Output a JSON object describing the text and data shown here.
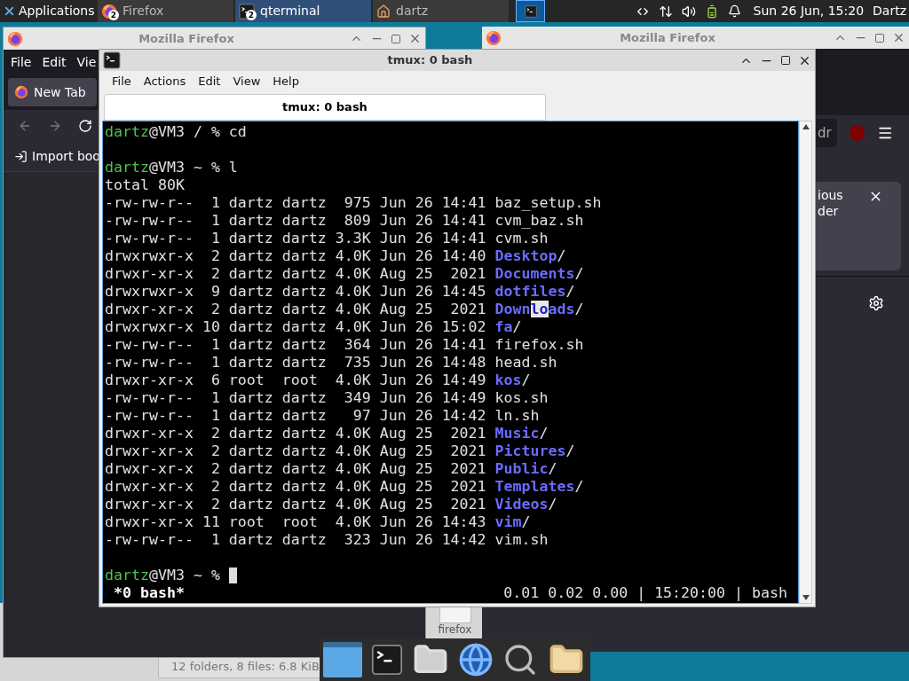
{
  "top_panel": {
    "apps_menu": "Applications",
    "tasks": [
      {
        "label": "Firefox",
        "badge": "2",
        "kind": "firefox",
        "selected": false
      },
      {
        "label": "qterminal",
        "badge": "2",
        "kind": "terminal",
        "selected": true
      },
      {
        "label": "dartz",
        "kind": "home",
        "selected": false
      }
    ],
    "clock": "Sun 26 Jun, 15:20",
    "user": "Dartz"
  },
  "firefox_left": {
    "title": "Mozilla Firefox",
    "menu": [
      "File",
      "Edit",
      "Vie"
    ],
    "tab": "New Tab",
    "bookmark": "Import boo"
  },
  "firefox_right": {
    "title": "Mozilla Firefox",
    "url_fragment": "dr",
    "notice_lines": [
      "ious",
      "der"
    ]
  },
  "file_manager": {
    "file_label": "firefox",
    "status": "12 folders, 8 files: 6.8 KiB"
  },
  "terminal": {
    "title": "tmux: 0 bash",
    "menu": [
      "File",
      "Actions",
      "Edit",
      "View",
      "Help"
    ],
    "tab": "tmux: 0 bash",
    "lines": [
      {
        "kind": "prompt",
        "user": "dartz",
        "rest": "@VM3 / % cd",
        "cursor": false
      },
      {
        "kind": "blank"
      },
      {
        "kind": "prompt",
        "user": "dartz",
        "rest": "@VM3 ~ % l",
        "cursor": false
      },
      {
        "kind": "text",
        "text": "total 80K"
      },
      {
        "kind": "entry",
        "info": "-rw-rw-r--  1 dartz dartz  975 Jun 26 14:41",
        "name": "baz_setup.sh",
        "dir": false
      },
      {
        "kind": "entry",
        "info": "-rw-rw-r--  1 dartz dartz  809 Jun 26 14:41",
        "name": "cvm_baz.sh",
        "dir": false
      },
      {
        "kind": "entry",
        "info": "-rw-rw-r--  1 dartz dartz 3.3K Jun 26 14:41",
        "name": "cvm.sh",
        "dir": false
      },
      {
        "kind": "entry",
        "info": "drwxrwxr-x  2 dartz dartz 4.0K Jun 26 14:40",
        "name": "Desktop",
        "suffix": "/",
        "dir": true
      },
      {
        "kind": "entry",
        "info": "drwxr-xr-x  2 dartz dartz 4.0K Aug 25  2021",
        "name": "Documents",
        "suffix": "/",
        "dir": true
      },
      {
        "kind": "entry",
        "info": "drwxrwxr-x  9 dartz dartz 4.0K Jun 26 14:45",
        "name": "dotfiles",
        "suffix": "/",
        "dir": true
      },
      {
        "kind": "entry",
        "info": "drwxr-xr-x  2 dartz dartz 4.0K Aug 25  2021",
        "name_segments": [
          {
            "text": "Down",
            "selected": false
          },
          {
            "text": "lo",
            "selected": true
          },
          {
            "text": "ads",
            "selected": false
          }
        ],
        "suffix": "/",
        "dir": true
      },
      {
        "kind": "entry",
        "info": "drwxrwxr-x 10 dartz dartz 4.0K Jun 26 15:02",
        "name": "fa",
        "suffix": "/",
        "dir": true
      },
      {
        "kind": "entry",
        "info": "-rw-rw-r--  1 dartz dartz  364 Jun 26 14:41",
        "name": "firefox.sh",
        "dir": false
      },
      {
        "kind": "entry",
        "info": "-rw-rw-r--  1 dartz dartz  735 Jun 26 14:48",
        "name": "head.sh",
        "dir": false
      },
      {
        "kind": "entry",
        "info": "drwxr-xr-x  6 root  root  4.0K Jun 26 14:49",
        "name": "kos",
        "suffix": "/",
        "dir": true
      },
      {
        "kind": "entry",
        "info": "-rw-rw-r--  1 dartz dartz  349 Jun 26 14:49",
        "name": "kos.sh",
        "dir": false
      },
      {
        "kind": "entry",
        "info": "-rw-rw-r--  1 dartz dartz   97 Jun 26 14:42",
        "name": "ln.sh",
        "dir": false
      },
      {
        "kind": "entry",
        "info": "drwxr-xr-x  2 dartz dartz 4.0K Aug 25  2021",
        "name": "Music",
        "suffix": "/",
        "dir": true
      },
      {
        "kind": "entry",
        "info": "drwxr-xr-x  2 dartz dartz 4.0K Aug 25  2021",
        "name": "Pictures",
        "suffix": "/",
        "dir": true
      },
      {
        "kind": "entry",
        "info": "drwxr-xr-x  2 dartz dartz 4.0K Aug 25  2021",
        "name": "Public",
        "suffix": "/",
        "dir": true
      },
      {
        "kind": "entry",
        "info": "drwxr-xr-x  2 dartz dartz 4.0K Aug 25  2021",
        "name": "Templates",
        "suffix": "/",
        "dir": true
      },
      {
        "kind": "entry",
        "info": "drwxr-xr-x  2 dartz dartz 4.0K Aug 25  2021",
        "name": "Videos",
        "suffix": "/",
        "dir": true
      },
      {
        "kind": "entry",
        "info": "drwxr-xr-x 11 root  root  4.0K Jun 26 14:43",
        "name": "vim",
        "suffix": "/",
        "dir": true
      },
      {
        "kind": "entry",
        "info": "-rw-rw-r--  1 dartz dartz  323 Jun 26 14:42",
        "name": "vim.sh",
        "dir": false
      },
      {
        "kind": "blank"
      },
      {
        "kind": "prompt",
        "user": "dartz",
        "rest": "@VM3 ~ % ",
        "cursor": true
      }
    ],
    "status_left": "*0 bash*",
    "status_right": "0.01 0.02 0.00 | 15:20:00 | bash"
  }
}
